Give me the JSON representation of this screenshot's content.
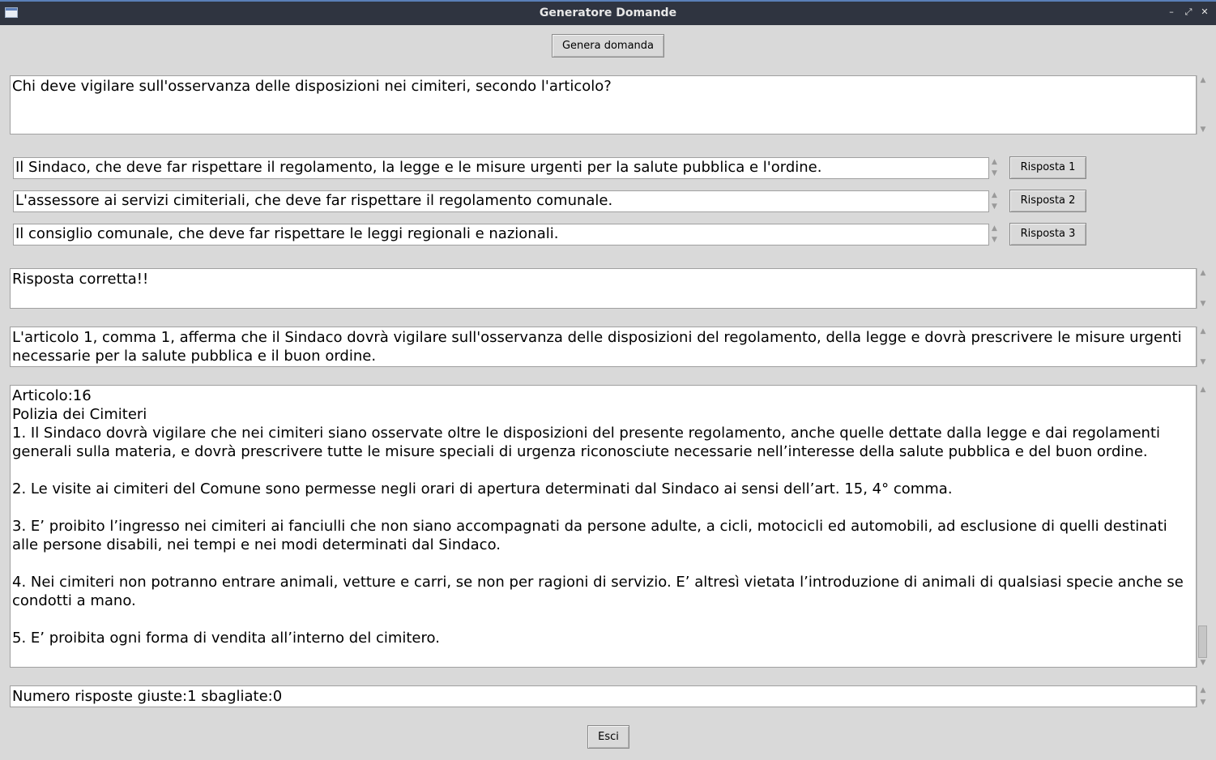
{
  "window": {
    "title": "Generatore Domande",
    "controls": {
      "minimize": "–",
      "maximize": "⤢",
      "close": "✕"
    }
  },
  "toolbar": {
    "generate_label": "Genera domanda"
  },
  "question": {
    "text": "Chi deve vigilare sull'osservanza delle disposizioni nei cimiteri, secondo l'articolo?"
  },
  "answers": [
    {
      "text": "Il Sindaco, che deve far rispettare il regolamento, la legge e le misure urgenti per la salute pubblica e l'ordine.",
      "button": "Risposta 1"
    },
    {
      "text": "L'assessore ai servizi cimiteriali, che deve far rispettare il regolamento comunale.",
      "button": "Risposta 2"
    },
    {
      "text": "Il consiglio comunale, che deve far rispettare le leggi regionali e nazionali.",
      "button": "Risposta 3"
    }
  ],
  "result": {
    "text": "Risposta corretta!!"
  },
  "explanation": {
    "text": "L'articolo 1, comma 1, afferma che il Sindaco dovrà vigilare sull'osservanza delle disposizioni del regolamento, della legge e dovrà prescrivere le misure urgenti necessarie per la salute pubblica e il buon ordine."
  },
  "article": {
    "text": "Articolo:16\nPolizia dei Cimiteri\n1. Il Sindaco dovrà vigilare che nei cimiteri siano osservate oltre le disposizioni del presente regolamento, anche quelle dettate dalla legge e dai regolamenti generali sulla materia, e dovrà prescrivere tutte le misure speciali di urgenza riconosciute necessarie nell’interesse della salute pubblica e del buon ordine.\n\n2. Le visite ai cimiteri del Comune sono permesse negli orari di apertura determinati dal Sindaco ai sensi dell’art. 15, 4° comma.\n\n3. E’ proibito l’ingresso nei cimiteri ai fanciulli che non siano accompagnati da persone adulte, a cicli, motocicli ed automobili, ad esclusione di quelli destinati alle persone disabili, nei tempi e nei modi determinati dal Sindaco.\n\n4. Nei cimiteri non potranno entrare animali, vetture e carri, se non per ragioni di servizio. E’ altresì vietata l’introduzione di animali di qualsiasi specie anche se condotti a mano.\n\n5. E’ proibita ogni forma di vendita all’interno del cimitero."
  },
  "score": {
    "text": "Numero risposte giuste:1 sbagliate:0"
  },
  "footer": {
    "exit_label": "Esci"
  },
  "icons": {
    "scroll_up": "▲",
    "scroll_down": "▼"
  }
}
